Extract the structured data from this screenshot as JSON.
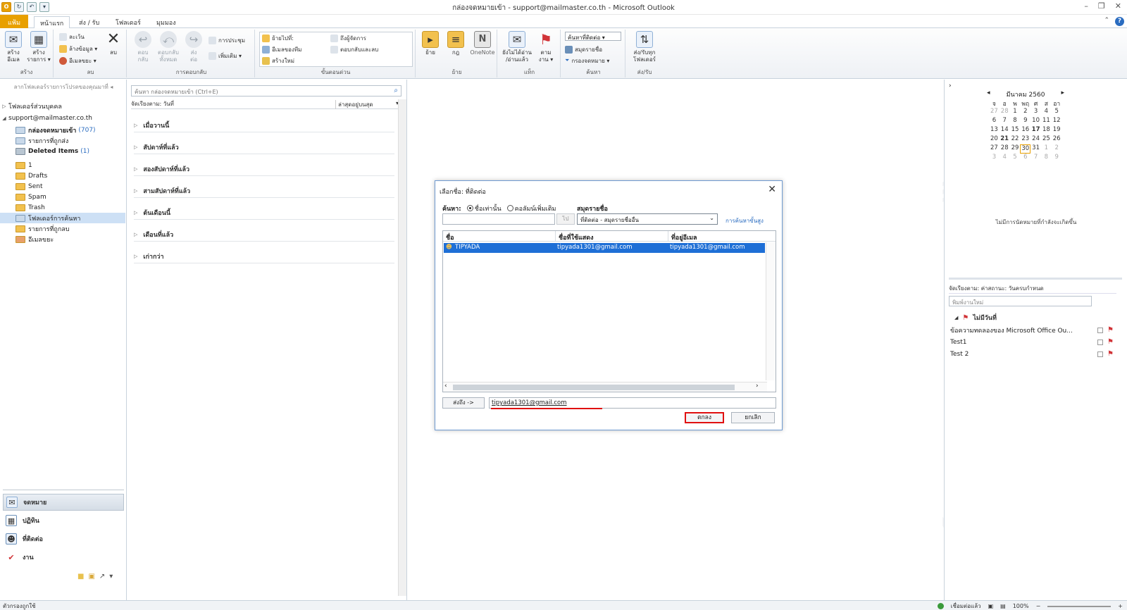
{
  "window": {
    "title": "กล่องจดหมายเข้า - support@mailmaster.co.th - Microsoft Outlook"
  },
  "tabs": {
    "file": "แฟ้ม",
    "items": [
      "หน้าแรก",
      "ส่ง / รับ",
      "โฟลเดอร์",
      "มุมมอง"
    ]
  },
  "ribbon": {
    "new": {
      "new_email": "สร้าง\nอีเมล",
      "new_items": "สร้าง\nรายการ ▾",
      "label": "สร้าง"
    },
    "delete": {
      "ignore": "ละเว้น",
      "cleanup": "ล้างข้อมูล ▾",
      "junk": "อีเมลขยะ ▾",
      "delete": "ลบ",
      "label": "ลบ"
    },
    "respond": {
      "reply": "ตอบ\nกลับ",
      "reply_all": "ตอบกลับ\nทั้งหมด",
      "forward": "ส่ง\nต่อ",
      "meeting": "การประชุม",
      "more": "เพิ่มเติม ▾",
      "label": "การตอบกลับ"
    },
    "quick_steps": {
      "move_to": "ย้ายไปที่:",
      "team_email": "อีเมลของทีม",
      "create_new": "สร้างใหม่",
      "to_manager": "ถึงผู้จัดการ",
      "reply_delete": "ตอบกลับและลบ",
      "label": "ขั้นตอนด่วน"
    },
    "move": {
      "move": "ย้าย",
      "rules": "กฎ",
      "onenote": "OneNote",
      "label": "ย้าย"
    },
    "tags": {
      "unread": "ยังไม่ได้อ่าน\n/อ่านแล้ว",
      "followup": "ตาม\nงาน ▾",
      "label": "แท็ก"
    },
    "find": {
      "search_contacts": "ค้นหาที่ติดต่อ",
      "address_book": "สมุดรายชื่อ",
      "filter": "กรองจดหมาย ▾",
      "label": "ค้นหา"
    },
    "send_receive": {
      "all": "ส่ง/รับทุก\nโฟลเดอร์",
      "label": "ส่ง/รับ"
    }
  },
  "folder_pane": {
    "drag_hint": "ลากโฟลเดอร์รายการโปรดของคุณมาที่",
    "favorites": "โฟลเดอร์ส่วนบุคคล",
    "account": "support@mailmaster.co.th",
    "folders": [
      {
        "name": "กล่องจดหมายเข้า",
        "count": "(707)"
      },
      {
        "name": "รายการที่ถูกส่ง",
        "count": ""
      },
      {
        "name": "Deleted Items",
        "count": "(1)"
      },
      {
        "name": "1",
        "count": ""
      },
      {
        "name": "Drafts",
        "count": ""
      },
      {
        "name": "Sent",
        "count": ""
      },
      {
        "name": "Spam",
        "count": ""
      },
      {
        "name": "Trash",
        "count": ""
      },
      {
        "name": "โฟลเดอร์การค้นหา",
        "count": ""
      },
      {
        "name": "รายการที่ถูกลบ",
        "count": ""
      },
      {
        "name": "อีเมลขยะ",
        "count": ""
      }
    ],
    "nav": {
      "mail": "จดหมาย",
      "calendar": "ปฏิทิน",
      "contacts": "ที่ติดต่อ",
      "tasks": "งาน"
    }
  },
  "message_list": {
    "search_placeholder": "ค้นหา กล่องจดหมายเข้า (Ctrl+E)",
    "arrange_by": "จัดเรียงตาม: วันที่",
    "sort_order": "ล่าสุดอยู่บนสุด",
    "groups": [
      "เมื่อวานนี้",
      "สัปดาห์ที่แล้ว",
      "สองสัปดาห์ที่แล้ว",
      "สามสัปดาห์ที่แล้ว",
      "ต้นเดือนนี้",
      "เดือนที่แล้ว",
      "เก่ากว่า"
    ]
  },
  "todo_bar": {
    "month": "มีนาคม 2560",
    "weekdays": [
      "จ",
      "อ",
      "พ",
      "พฤ",
      "ศ",
      "ส",
      "อา"
    ],
    "weeks": [
      [
        "27",
        "28",
        "1",
        "2",
        "3",
        "4",
        "5"
      ],
      [
        "6",
        "7",
        "8",
        "9",
        "10",
        "11",
        "12"
      ],
      [
        "13",
        "14",
        "15",
        "16",
        "17",
        "18",
        "19"
      ],
      [
        "20",
        "21",
        "22",
        "23",
        "24",
        "25",
        "26"
      ],
      [
        "27",
        "28",
        "29",
        "30",
        "31",
        "1",
        "2"
      ],
      [
        "3",
        "4",
        "5",
        "6",
        "7",
        "8",
        "9"
      ]
    ],
    "no_appointments": "ไม่มีการนัดหมายที่กำลังจะเกิดขึ้น",
    "task_arrange": "จัดเรียงตาม: ค่าสถานะ: วันครบกำหนด",
    "new_task_placeholder": "พิมพ์งานใหม่",
    "task_group": "ไม่มีวันที่",
    "tasks": [
      "ข้อความทดลองของ Microsoft Office Ou...",
      "Test1",
      "Test 2"
    ]
  },
  "dialog": {
    "title": "เลือกชื่อ: ที่ติดต่อ",
    "search_label": "ค้นหา:",
    "name_only": "ชื่อเท่านั้น",
    "more_columns": "คอลัมน์เพิ่มเติม",
    "address_book_label": "สมุดรายชื่อ",
    "go": "ไป",
    "address_book_value": "ที่ติดต่อ - สมุดรายชื่ออื่น",
    "advanced_find": "การค้นหาขั้นสูง",
    "columns": [
      "ชื่อ",
      "ชื่อที่ใช้แสดง",
      "ที่อยู่อีเมล"
    ],
    "rows": [
      {
        "name": "TIPYADA",
        "display": "tipyada1301@gmail.com",
        "email": "tipyada1301@gmail.com"
      }
    ],
    "to_button": "ส่งถึง ->",
    "to_value": "tipyada1301@gmail.com",
    "ok": "ตกลง",
    "cancel": "ยกเลิก"
  },
  "status_bar": {
    "left": "ตัวกรองถูกใช้",
    "connection": "เชื่อมต่อแล้ว",
    "zoom": "100%"
  },
  "colors": {
    "accent": "#e8a000",
    "selection": "#1e6fd6",
    "highlight_red": "#e01010",
    "link": "#2a6cc0"
  }
}
